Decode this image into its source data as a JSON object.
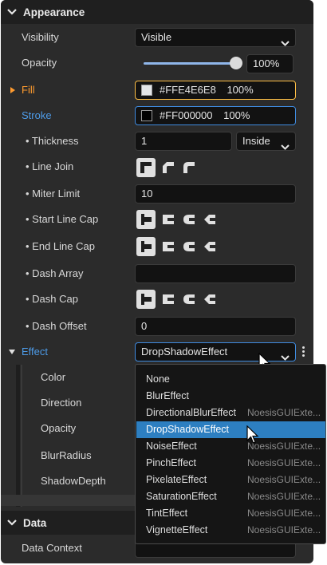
{
  "appearance": {
    "title": "Appearance",
    "visibility": {
      "label": "Visibility",
      "value": "Visible"
    },
    "opacity": {
      "label": "Opacity",
      "value": "100%",
      "level": 1.0
    },
    "fill": {
      "label": "Fill",
      "color_text": "#FFE4E6E8",
      "alpha": "100%",
      "swatch": "#E4E6E8"
    },
    "stroke": {
      "label": "Stroke",
      "color_text": "#FF000000",
      "alpha": "100%",
      "swatch": "#000000"
    },
    "thickness": {
      "label": "• Thickness",
      "value": "1",
      "alignment": "Inside"
    },
    "line_join": {
      "label": "• Line Join"
    },
    "miter_limit": {
      "label": "• Miter Limit",
      "value": "10"
    },
    "start_line_cap": {
      "label": "• Start Line Cap"
    },
    "end_line_cap": {
      "label": "• End Line Cap"
    },
    "dash_array": {
      "label": "• Dash Array",
      "value": ""
    },
    "dash_cap": {
      "label": "• Dash Cap"
    },
    "dash_offset": {
      "label": "• Dash Offset",
      "value": "0"
    },
    "effect": {
      "label": "Effect",
      "value": "DropShadowEffect",
      "sub_properties": [
        "Color",
        "Direction",
        "Opacity",
        "BlurRadius",
        "ShadowDepth"
      ]
    }
  },
  "data_section": {
    "title": "Data",
    "data_context": {
      "label": "Data Context"
    }
  },
  "effect_dropdown": {
    "options": [
      {
        "name": "None",
        "assembly": ""
      },
      {
        "name": "BlurEffect",
        "assembly": ""
      },
      {
        "name": "DirectionalBlurEffect",
        "assembly": "NoesisGUIExte..."
      },
      {
        "name": "DropShadowEffect",
        "assembly": ""
      },
      {
        "name": "NoiseEffect",
        "assembly": "NoesisGUIExte..."
      },
      {
        "name": "PinchEffect",
        "assembly": "NoesisGUIExte..."
      },
      {
        "name": "PixelateEffect",
        "assembly": "NoesisGUIExte..."
      },
      {
        "name": "SaturationEffect",
        "assembly": "NoesisGUIExte..."
      },
      {
        "name": "TintEffect",
        "assembly": "NoesisGUIExte..."
      },
      {
        "name": "VignetteEffect",
        "assembly": "NoesisGUIExte..."
      }
    ],
    "selected_index": 3
  },
  "colors": {
    "accent_blue": "#4D9BE8",
    "accent_orange": "#FF9B2F",
    "selection": "#2D7FC1"
  }
}
